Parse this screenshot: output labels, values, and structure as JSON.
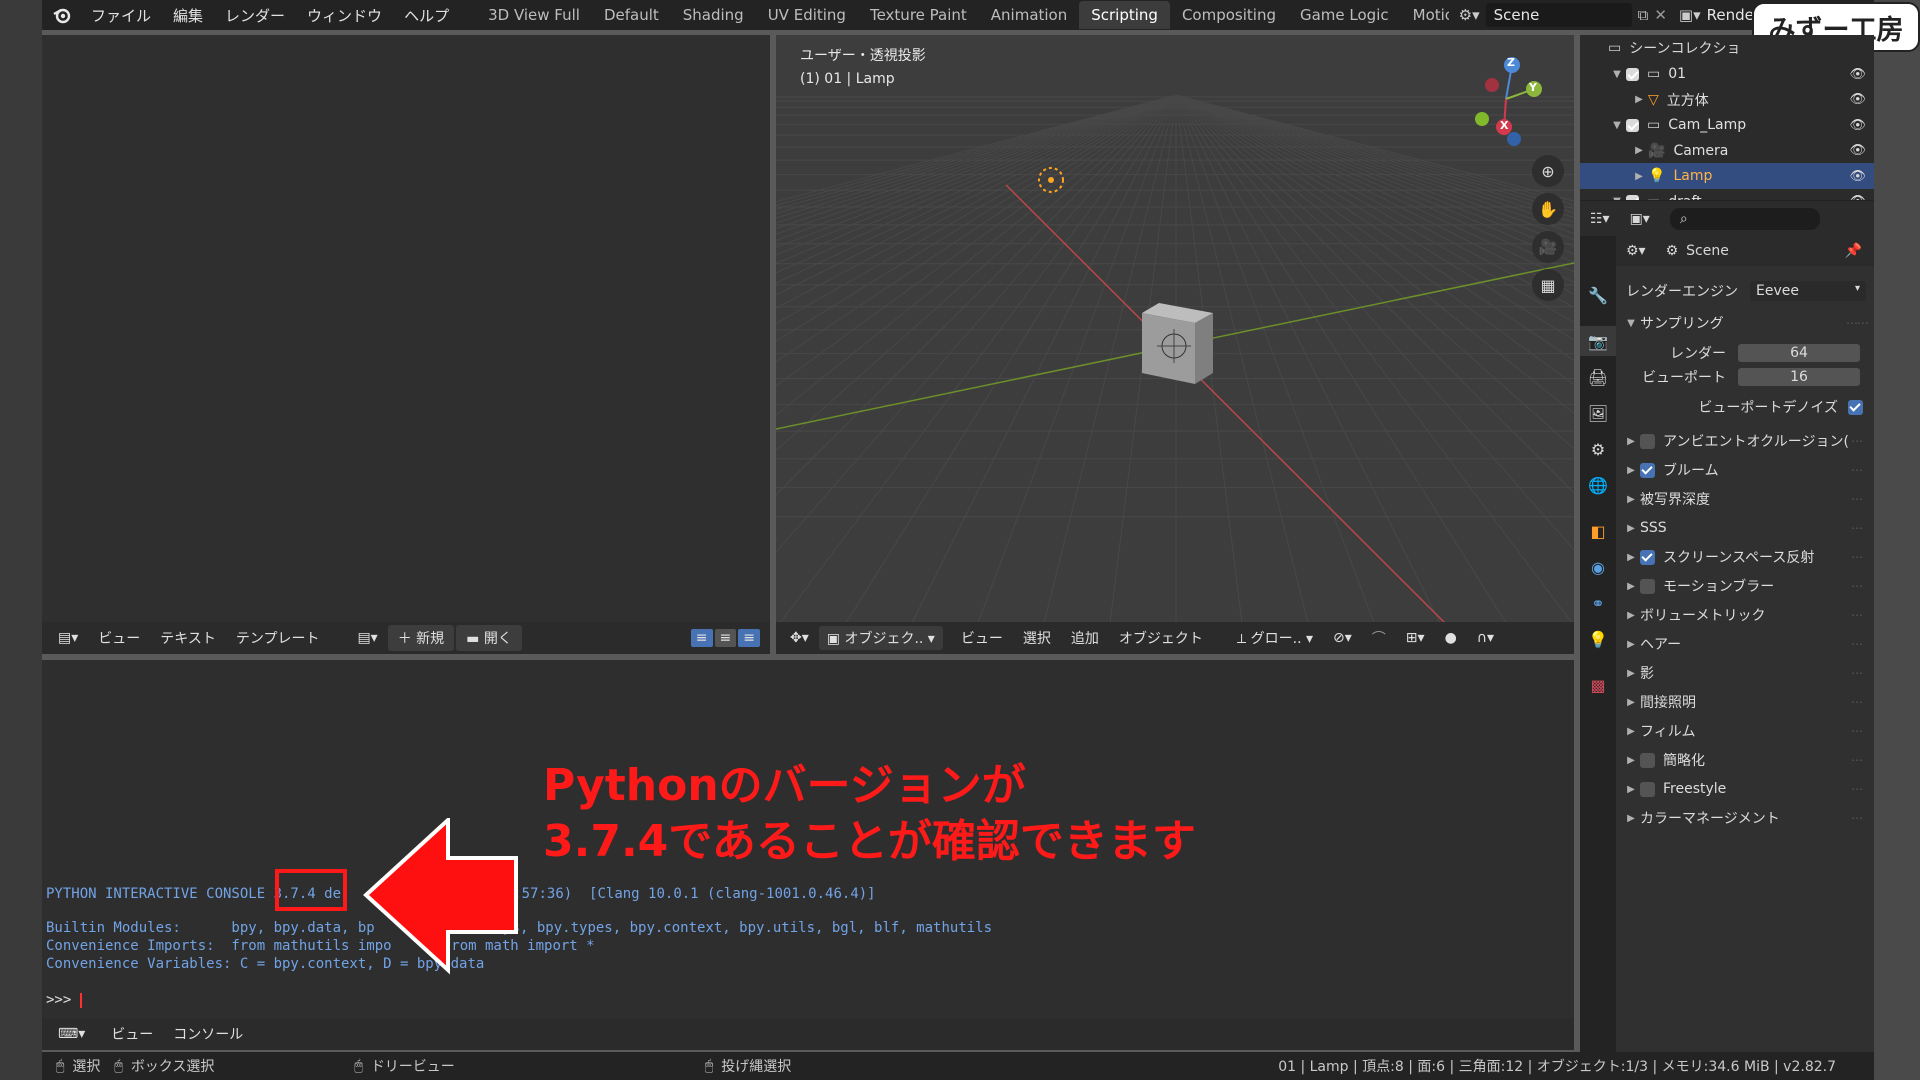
{
  "topbar": {
    "menus": [
      "ファイル",
      "編集",
      "レンダー",
      "ウィンドウ",
      "ヘルプ"
    ],
    "workspaces": [
      "3D View Full",
      "Default",
      "Shading",
      "UV Editing",
      "Texture Paint",
      "Animation",
      "Scripting",
      "Compositing",
      "Game Logic",
      "Motic"
    ],
    "active_workspace": "Scripting",
    "scene_name": "Scene",
    "view_layer": "RenderLay"
  },
  "watermark": "みずー工房",
  "text_editor": {
    "header": {
      "view": "ビュー",
      "text": "テキスト",
      "template": "テンプレート",
      "new": "新規",
      "open": "開く"
    }
  },
  "viewport": {
    "title": "ユーザー・透視投影",
    "subtitle": "(1) 01 | Lamp",
    "gizmo": {
      "z": "Z",
      "y": "Y",
      "x": "X"
    },
    "header": {
      "mode": "オブジェク..",
      "view": "ビュー",
      "select": "選択",
      "add": "追加",
      "object": "オブジェクト",
      "transform": "グロー.."
    }
  },
  "outliner": {
    "title": "シーンコレクショ",
    "rows": [
      {
        "name": "01",
        "kind": "collection",
        "indent": 1,
        "selected": false
      },
      {
        "name": "立方体",
        "kind": "mesh",
        "indent": 2,
        "selected": false
      },
      {
        "name": "Cam_Lamp",
        "kind": "collection",
        "indent": 1,
        "selected": false
      },
      {
        "name": "Camera",
        "kind": "camera",
        "indent": 2,
        "selected": false
      },
      {
        "name": "Lamp",
        "kind": "light",
        "indent": 2,
        "selected": true
      },
      {
        "name": "draft",
        "kind": "collection",
        "indent": 1,
        "selected": false
      }
    ]
  },
  "properties": {
    "scene": "Scene",
    "render_engine_label": "レンダーエンジン",
    "render_engine": "Eevee",
    "sampling_label": "サンプリング",
    "render_label": "レンダー",
    "render_samples": "64",
    "viewport_label": "ビューポート",
    "viewport_samples": "16",
    "denoise_label": "ビューポートデノイズ",
    "denoise": true,
    "panels": [
      {
        "label": "アンビエントオクルージョン(",
        "checkbox": true,
        "checked": false
      },
      {
        "label": "ブルーム",
        "checkbox": true,
        "checked": true
      },
      {
        "label": "被写界深度",
        "checkbox": false,
        "checked": false
      },
      {
        "label": "SSS",
        "checkbox": false,
        "checked": false
      },
      {
        "label": "スクリーンスペース反射",
        "checkbox": true,
        "checked": true
      },
      {
        "label": "モーションブラー",
        "checkbox": true,
        "checked": false
      },
      {
        "label": "ボリューメトリック",
        "checkbox": false,
        "checked": false
      },
      {
        "label": "ヘアー",
        "checkbox": false,
        "checked": false
      },
      {
        "label": "影",
        "checkbox": false,
        "checked": false
      },
      {
        "label": "間接照明",
        "checkbox": false,
        "checked": false
      },
      {
        "label": "フィルム",
        "checkbox": false,
        "checked": false
      },
      {
        "label": "簡略化",
        "checkbox": true,
        "checked": false
      },
      {
        "label": "Freestyle",
        "checkbox": true,
        "checked": false
      },
      {
        "label": "カラーマネージメント",
        "checkbox": false,
        "checked": false
      }
    ]
  },
  "console": {
    "line1_a": "PYTHON INTERACTIVE CONSOLE ",
    "version": "3.7.4",
    "line1_b": " de",
    "line1_c": "9, 15:57:36)  [Clang 10.0.1 (clang-1001.0.46.4)]",
    "builtin_label": "Builtin Modules:      bpy, bpy.data, bp",
    "builtin_rest": "ops, bpy.types, bpy.context, bpy.utils, bgl, blf, mathutils",
    "imports_a": "Convenience Imports:  from mathutils impo",
    "imports_b": "*; from math import *",
    "vars_a": "Convenience Variables: C = bpy.context, D = b",
    "vars_b": "py.data",
    "prompt": ">>> ",
    "header": {
      "view": "ビュー",
      "console": "コンソール"
    }
  },
  "annotation": {
    "line1": "Pythonのバージョンが",
    "line2": "3.7.4であることが確認できます",
    "color": "#ff1a1a"
  },
  "statusbar": {
    "select": "選択",
    "box_select": "ボックス選択",
    "dolly": "ドリービュー",
    "lasso": "投げ縄選択",
    "stats": "01 | Lamp | 頂点:8 | 面:6 | 三角面:12 | オブジェクト:1/3 | メモリ:34.6 MiB | v2.82.7"
  }
}
